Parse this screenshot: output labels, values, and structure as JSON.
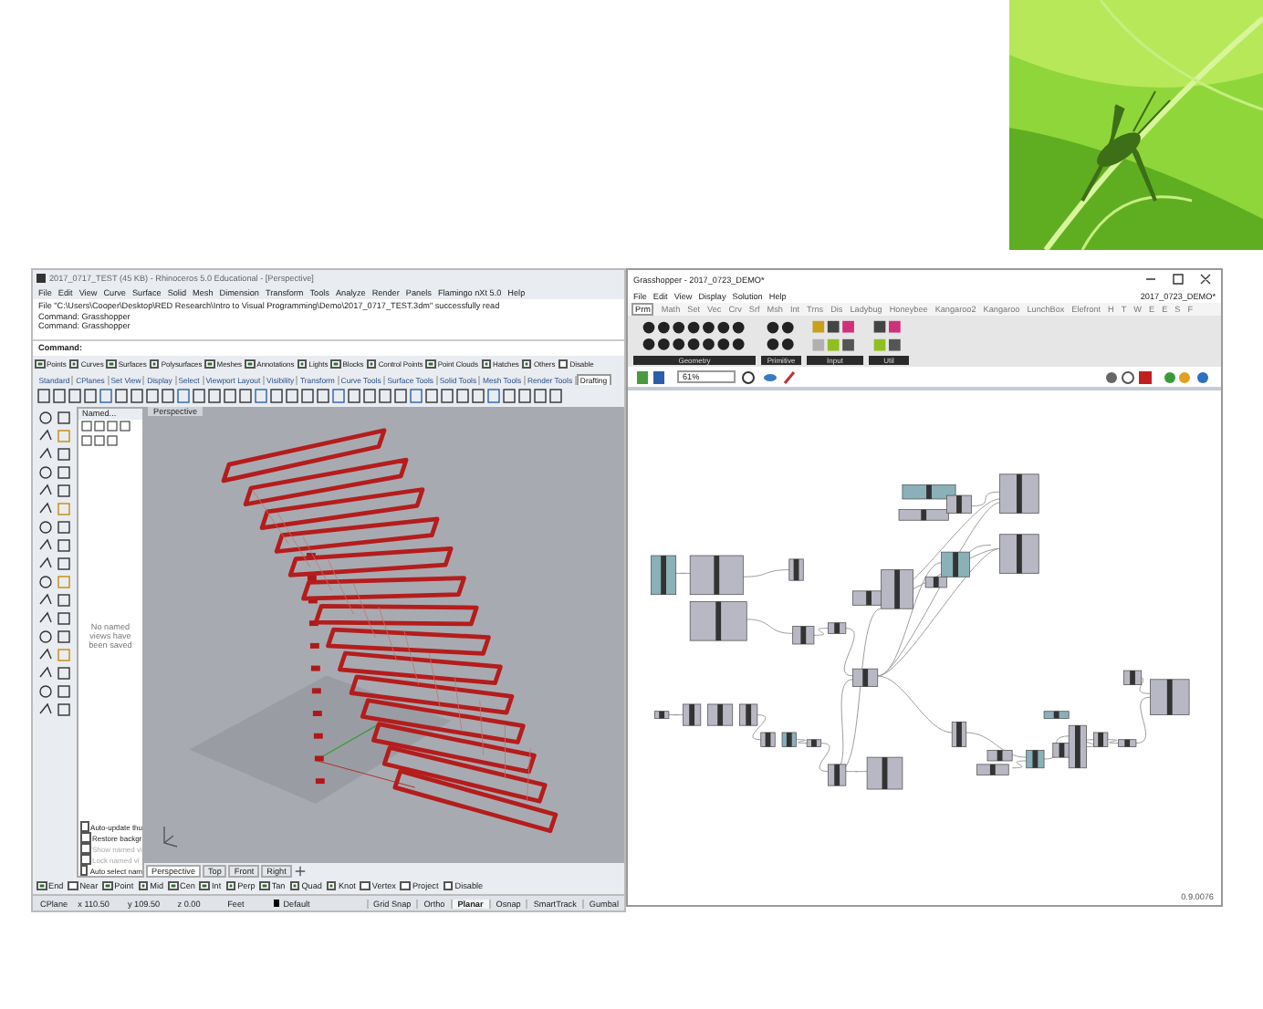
{
  "rhino": {
    "title": "2017_0717_TEST (45 KB) - Rhinoceros 5.0 Educational - [Perspective]",
    "menu": [
      "File",
      "Edit",
      "View",
      "Curve",
      "Surface",
      "Solid",
      "Mesh",
      "Dimension",
      "Transform",
      "Tools",
      "Analyze",
      "Render",
      "Panels",
      "Flamingo nXt 5.0",
      "Help"
    ],
    "command_history": [
      "File \"C:\\Users\\Cooper\\Desktop\\RED Research\\Intro to Visual Programming\\Demo\\2017_0717_TEST.3dm\" successfully read",
      "Command: Grasshopper",
      "Command: Grasshopper"
    ],
    "command_prompt": "Command:",
    "filters": [
      {
        "label": "Points",
        "checked": true
      },
      {
        "label": "Curves",
        "checked": true
      },
      {
        "label": "Surfaces",
        "checked": true
      },
      {
        "label": "Polysurfaces",
        "checked": true
      },
      {
        "label": "Meshes",
        "checked": true
      },
      {
        "label": "Annotations",
        "checked": true
      },
      {
        "label": "Lights",
        "checked": true
      },
      {
        "label": "Blocks",
        "checked": true
      },
      {
        "label": "Control Points",
        "checked": true
      },
      {
        "label": "Point Clouds",
        "checked": true
      },
      {
        "label": "Hatches",
        "checked": true
      },
      {
        "label": "Others",
        "checked": true
      },
      {
        "label": "Disable",
        "checked": false
      }
    ],
    "toolbar_tabs": [
      {
        "label": "Standard",
        "selected": false
      },
      {
        "label": "CPlanes",
        "selected": false
      },
      {
        "label": "Set View",
        "selected": false
      },
      {
        "label": "Display",
        "selected": false
      },
      {
        "label": "Select",
        "selected": false
      },
      {
        "label": "Viewport Layout",
        "selected": false
      },
      {
        "label": "Visibility",
        "selected": false
      },
      {
        "label": "Transform",
        "selected": false
      },
      {
        "label": "Curve Tools",
        "selected": false
      },
      {
        "label": "Surface Tools",
        "selected": false
      },
      {
        "label": "Solid Tools",
        "selected": false
      },
      {
        "label": "Mesh Tools",
        "selected": false
      },
      {
        "label": "Render Tools",
        "selected": false
      },
      {
        "label": "Drafting",
        "selected": true
      }
    ],
    "named_views": {
      "tab": "Named...",
      "empty_message": "No named views have been saved",
      "options": [
        {
          "label": "Auto-update thu",
          "checked": false,
          "disabled": false
        },
        {
          "label": "Restore backgr",
          "checked": false,
          "disabled": false
        },
        {
          "label": "Show named vi",
          "checked": false,
          "disabled": true
        },
        {
          "label": "Lock named vi",
          "checked": false,
          "disabled": true
        },
        {
          "label": "Auto select nam",
          "checked": false,
          "disabled": false
        }
      ]
    },
    "viewport": {
      "title": "Perspective"
    },
    "viewport_tabs": [
      {
        "label": "Perspective",
        "selected": true
      },
      {
        "label": "Top",
        "selected": false
      },
      {
        "label": "Front",
        "selected": false
      },
      {
        "label": "Right",
        "selected": false
      }
    ],
    "osnaps": [
      {
        "label": "End",
        "checked": true
      },
      {
        "label": "Near",
        "checked": false
      },
      {
        "label": "Point",
        "checked": true
      },
      {
        "label": "Mid",
        "checked": true
      },
      {
        "label": "Cen",
        "checked": true
      },
      {
        "label": "Int",
        "checked": true
      },
      {
        "label": "Perp",
        "checked": true
      },
      {
        "label": "Tan",
        "checked": true
      },
      {
        "label": "Quad",
        "checked": true
      },
      {
        "label": "Knot",
        "checked": true
      },
      {
        "label": "Vertex",
        "checked": false
      },
      {
        "label": "Project",
        "checked": false
      },
      {
        "label": "Disable",
        "checked": false
      }
    ],
    "status": {
      "cplane": "CPlane",
      "x": "x 110.50",
      "y": "y 109.50",
      "z": "z 0.00",
      "units": "Feet",
      "layer": "Default",
      "toggles": [
        {
          "label": "Grid Snap",
          "on": false
        },
        {
          "label": "Ortho",
          "on": false
        },
        {
          "label": "Planar",
          "on": true
        },
        {
          "label": "Osnap",
          "on": false
        },
        {
          "label": "SmartTrack",
          "on": false
        },
        {
          "label": "Gumbal",
          "on": false
        }
      ]
    }
  },
  "grasshopper": {
    "title": "Grasshopper - 2017_0723_DEMO*",
    "menu": [
      "File",
      "Edit",
      "View",
      "Display",
      "Solution",
      "Help"
    ],
    "document": "2017_0723_DEMO*",
    "tabs": [
      {
        "label": "Prm",
        "selected": true
      },
      {
        "label": "Math",
        "selected": false
      },
      {
        "label": "Set",
        "selected": false
      },
      {
        "label": "Vec",
        "selected": false
      },
      {
        "label": "Crv",
        "selected": false
      },
      {
        "label": "Srf",
        "selected": false
      },
      {
        "label": "Msh",
        "selected": false
      },
      {
        "label": "Int",
        "selected": false
      },
      {
        "label": "Trns",
        "selected": false
      },
      {
        "label": "Dis",
        "selected": false
      },
      {
        "label": "Ladybug",
        "selected": false
      },
      {
        "label": "Honeybee",
        "selected": false
      },
      {
        "label": "Kangaroo2",
        "selected": false
      },
      {
        "label": "Kangaroo",
        "selected": false
      },
      {
        "label": "LunchBox",
        "selected": false
      },
      {
        "label": "Elefront",
        "selected": false
      },
      {
        "label": "H",
        "selected": false
      },
      {
        "label": "T",
        "selected": false
      },
      {
        "label": "W",
        "selected": false
      },
      {
        "label": "E",
        "selected": false
      },
      {
        "label": "E",
        "selected": false
      },
      {
        "label": "S",
        "selected": false
      },
      {
        "label": "F",
        "selected": false
      }
    ],
    "groups": [
      {
        "label": "Geometry"
      },
      {
        "label": "Primitive"
      },
      {
        "label": "Input"
      },
      {
        "label": "Util"
      }
    ],
    "zoom": "61%",
    "version": "0.9.0076"
  }
}
